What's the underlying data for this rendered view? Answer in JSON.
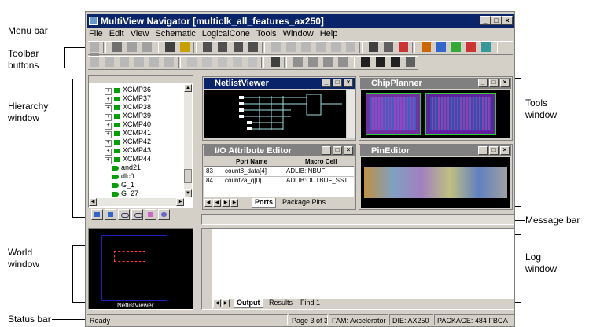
{
  "callouts": {
    "menu_bar": "Menu bar",
    "toolbar_buttons_1": "Toolbar",
    "toolbar_buttons_2": "buttons",
    "hierarchy_window_1": "Hierarchy",
    "hierarchy_window_2": "window",
    "tools_window_1": "Tools",
    "tools_window_2": "window",
    "message_bar": "Message bar",
    "world_window_1": "World",
    "world_window_2": "window",
    "log_window_1": "Log",
    "log_window_2": "window",
    "status_bar": "Status bar"
  },
  "app": {
    "title": "MultiView Navigator [multiclk_all_features_ax250]"
  },
  "menu": [
    "File",
    "Edit",
    "View",
    "Schematic",
    "LogicalCone",
    "Tools",
    "Window",
    "Help"
  ],
  "hierarchy": {
    "items": [
      "XCMP36",
      "XCMP37",
      "XCMP38",
      "XCMP39",
      "XCMP40",
      "XCMP41",
      "XCMP42",
      "XCMP43",
      "XCMP44",
      "and21",
      "dlc0",
      "G_1",
      "G_27"
    ]
  },
  "netlist_viewer": {
    "title": "NetlistViewer"
  },
  "chip_planner": {
    "title": "ChipPlanner"
  },
  "io_editor": {
    "title": "I/O Attribute Editor",
    "columns": [
      "Port Name",
      "Macro Cell"
    ],
    "rows": [
      {
        "num": "83",
        "port": "count8_data[4]",
        "macro": "ADLIB:INBUF"
      },
      {
        "num": "84",
        "port": "count2a_q[0]",
        "macro": "ADLIB:OUTBUF_SST"
      }
    ],
    "tabs": [
      "Ports",
      "Package Pins"
    ]
  },
  "pin_editor": {
    "title": "PinEditor"
  },
  "world": {
    "label": "NetlistViewer"
  },
  "log": {
    "tabs": [
      "Output",
      "Results",
      "Find 1"
    ]
  },
  "status": {
    "ready": "Ready",
    "page": "Page 3 of 3",
    "fam": "FAM: Axcelerator",
    "die": "DIE: AX250",
    "package": "PACKAGE: 484 FBGA"
  }
}
